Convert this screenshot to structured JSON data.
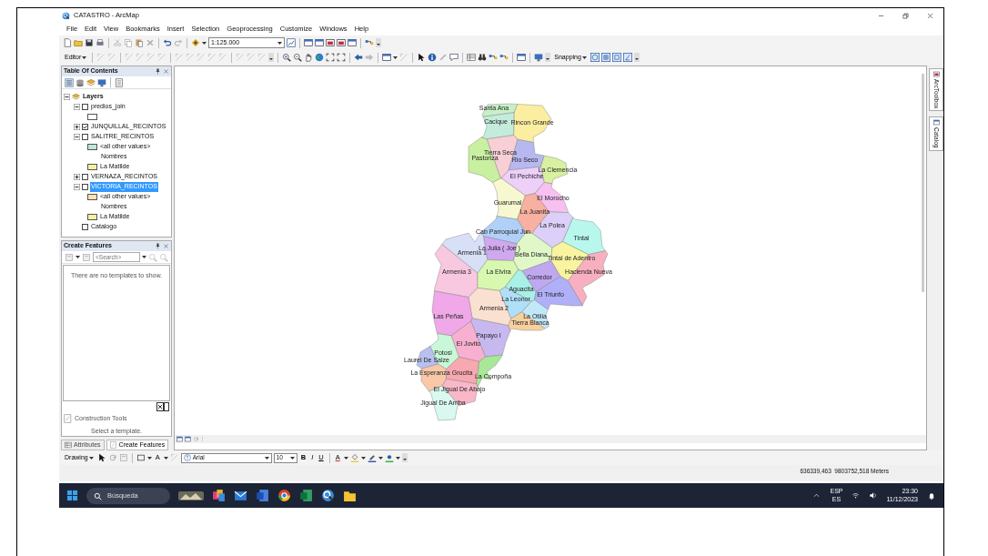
{
  "window": {
    "title": "CATASTRO - ArcMap"
  },
  "menu": [
    "File",
    "Edit",
    "View",
    "Bookmarks",
    "Insert",
    "Selection",
    "Geoprocessing",
    "Customize",
    "Windows",
    "Help"
  ],
  "standard_toolbar": {
    "scale": "1:125.000"
  },
  "editor_toolbar": {
    "editor": "Editor",
    "snapping": "Snapping"
  },
  "table_of_contents": {
    "title": "Table Of Contents",
    "tree": [
      {
        "label": "Layers",
        "kind": "frame",
        "expanded": true,
        "children": [
          {
            "label": "predios_join",
            "kind": "layer",
            "checked": false,
            "expanded": true,
            "selected": false,
            "children": [
              {
                "kind": "symbol",
                "color": "#ffffff"
              }
            ]
          },
          {
            "label": "JUNQUILLAL_RECINTOS",
            "kind": "layer",
            "checked": true,
            "expanded": false,
            "selected": false
          },
          {
            "label": "SALITRE_RECINTOS",
            "kind": "layer",
            "checked": false,
            "expanded": true,
            "selected": false,
            "children": [
              {
                "kind": "symbol",
                "label": "<all other values>",
                "color": "#bfe8dc"
              },
              {
                "kind": "heading",
                "label": "Nombres"
              },
              {
                "kind": "symbol",
                "label": "La Matilde",
                "color": "#f6f0a0"
              }
            ]
          },
          {
            "label": "VERNAZA_RECINTOS",
            "kind": "layer",
            "checked": false,
            "expanded": false,
            "selected": false
          },
          {
            "label": "VICTORIA_RECINTOS",
            "kind": "layer",
            "checked": false,
            "expanded": true,
            "selected": true,
            "children": [
              {
                "kind": "symbol",
                "label": "<all other values>",
                "color": "#fde2b4"
              },
              {
                "kind": "heading",
                "label": "Nombres"
              },
              {
                "kind": "symbol",
                "label": "La Matilde",
                "color": "#f6f0a0"
              }
            ]
          },
          {
            "label": "Catalogo",
            "kind": "table",
            "checked": false,
            "selected": false
          }
        ]
      }
    ]
  },
  "create_features": {
    "title": "Create Features",
    "search": {
      "placeholder": "<Search>"
    },
    "message": "There are no templates to show.",
    "construction_tools": "Construction Tools",
    "hint": "Select a template."
  },
  "dock_tabs": [
    {
      "label": "Attributes",
      "selected": false
    },
    {
      "label": "Create Features",
      "selected": true
    }
  ],
  "map": {
    "regions": [
      {
        "name": "Santa Ana",
        "color": "#c8f0c8"
      },
      {
        "name": "Cacique",
        "color": "#c4ecdc"
      },
      {
        "name": "Rincon Grande",
        "color": "#fbeea0"
      },
      {
        "name": "Tierra Seca",
        "color": "#f9cfd6"
      },
      {
        "name": "Pastoriza",
        "color": "#c9f0a0"
      },
      {
        "name": "Rio Seco",
        "color": "#b8b8f0"
      },
      {
        "name": "La Clemencia",
        "color": "#d8f0a0"
      },
      {
        "name": "El Pechiche",
        "color": "#ecd0f8"
      },
      {
        "name": "El Morocho",
        "color": "#f8c0f0"
      },
      {
        "name": "Guarumal",
        "color": "#f8f8d0"
      },
      {
        "name": "La Juanita",
        "color": "#f8b0a0"
      },
      {
        "name": "La Polea",
        "color": "#dcd0f8"
      },
      {
        "name": "Tintal",
        "color": "#b8f8ec"
      },
      {
        "name": "Cab Parroquial Jun",
        "color": "#b0d0f8"
      },
      {
        "name": "La Julia ( Joe )",
        "color": "#d0a8f0"
      },
      {
        "name": "Armenia 1",
        "color": "#d8e0f8"
      },
      {
        "name": "Bella Diana",
        "color": "#e0f8c8"
      },
      {
        "name": "Tintal de Adentro",
        "color": "#f8f4a0"
      },
      {
        "name": "Armenia 3",
        "color": "#f8c8e0"
      },
      {
        "name": "La Elvira",
        "color": "#d8f8b0"
      },
      {
        "name": "Hacienda Nueva",
        "color": "#f8b0c0"
      },
      {
        "name": "Corredor",
        "color": "#c0a8f0"
      },
      {
        "name": "Aguacita",
        "color": "#a8f0e8"
      },
      {
        "name": "La Leonor",
        "color": "#b0e0f8"
      },
      {
        "name": "El Triunfo",
        "color": "#b0b0f8"
      },
      {
        "name": "Armenia 2",
        "color": "#fae0d0"
      },
      {
        "name": "Las Peñas",
        "color": "#f0a8e8"
      },
      {
        "name": "La Otilia",
        "color": "#c0e8f8"
      },
      {
        "name": "Tierra Blanca",
        "color": "#f8d0a0"
      },
      {
        "name": "Papayo I",
        "color": "#c8b8f0"
      },
      {
        "name": "El Jovito",
        "color": "#f8b0d0"
      },
      {
        "name": "Potosi",
        "color": "#c8f8d8"
      },
      {
        "name": "Laurel De Salze",
        "color": "#b8c0f0"
      },
      {
        "name": "La Esperanza",
        "color": "#f8c8a8"
      },
      {
        "name": "Grucita",
        "color": "#f8a8b0"
      },
      {
        "name": "La Compoña",
        "color": "#a8e898"
      },
      {
        "name": "El Jigual De Abajo",
        "color": "#f8b8c8"
      },
      {
        "name": "Jigual De Arriba",
        "color": "#d8f8f0"
      }
    ]
  },
  "side_tabs": [
    "ArcToolbox",
    "Catalog"
  ],
  "drawing_toolbar": {
    "drawing": "Drawing",
    "text_tool": "A",
    "font": "Arial",
    "size": "10",
    "bold": "B",
    "italic": "I",
    "underline": "U",
    "font_color": "A"
  },
  "status_bar": {
    "coordinates": "636339,463  9803752,518 Meters"
  },
  "taskbar": {
    "search": {
      "placeholder": "Búsqueda"
    },
    "language": "ESP",
    "layout": "ES",
    "time": "23:30",
    "date": "11/12/2023"
  }
}
